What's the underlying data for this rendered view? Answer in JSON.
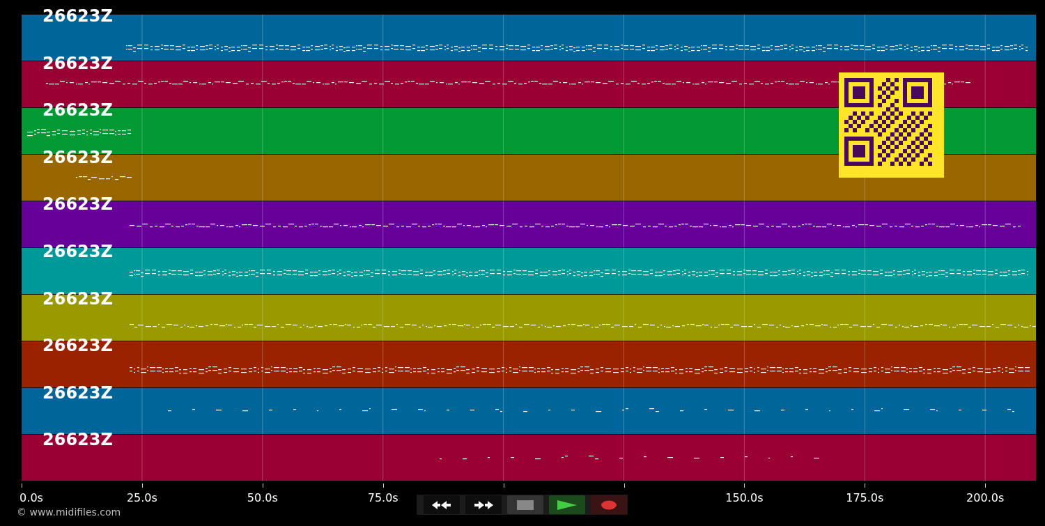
{
  "tracks": [
    {
      "label": "26623Z",
      "color": "#006699"
    },
    {
      "label": "26623Z",
      "color": "#990033"
    },
    {
      "label": "26623Z",
      "color": "#009933"
    },
    {
      "label": "26623Z",
      "color": "#996600"
    },
    {
      "label": "26623Z",
      "color": "#660099"
    },
    {
      "label": "26623Z",
      "color": "#009999"
    },
    {
      "label": "26623Z",
      "color": "#999900"
    },
    {
      "label": "26623Z",
      "color": "#992200"
    },
    {
      "label": "26623Z",
      "color": "#006699"
    },
    {
      "label": "26623Z",
      "color": "#990033"
    }
  ],
  "axis": {
    "labels_left": [
      "0.0s",
      "25.0s",
      "50.0s",
      "75.0s"
    ],
    "labels_right": [
      "150.0s",
      "175.0s",
      "200.0s"
    ]
  },
  "controls": [
    {
      "kind": "rewind"
    },
    {
      "kind": "forward"
    },
    {
      "kind": "stop"
    },
    {
      "kind": "play"
    },
    {
      "kind": "record"
    }
  ],
  "footer": {
    "copyright": "© www.midifiles.com"
  }
}
